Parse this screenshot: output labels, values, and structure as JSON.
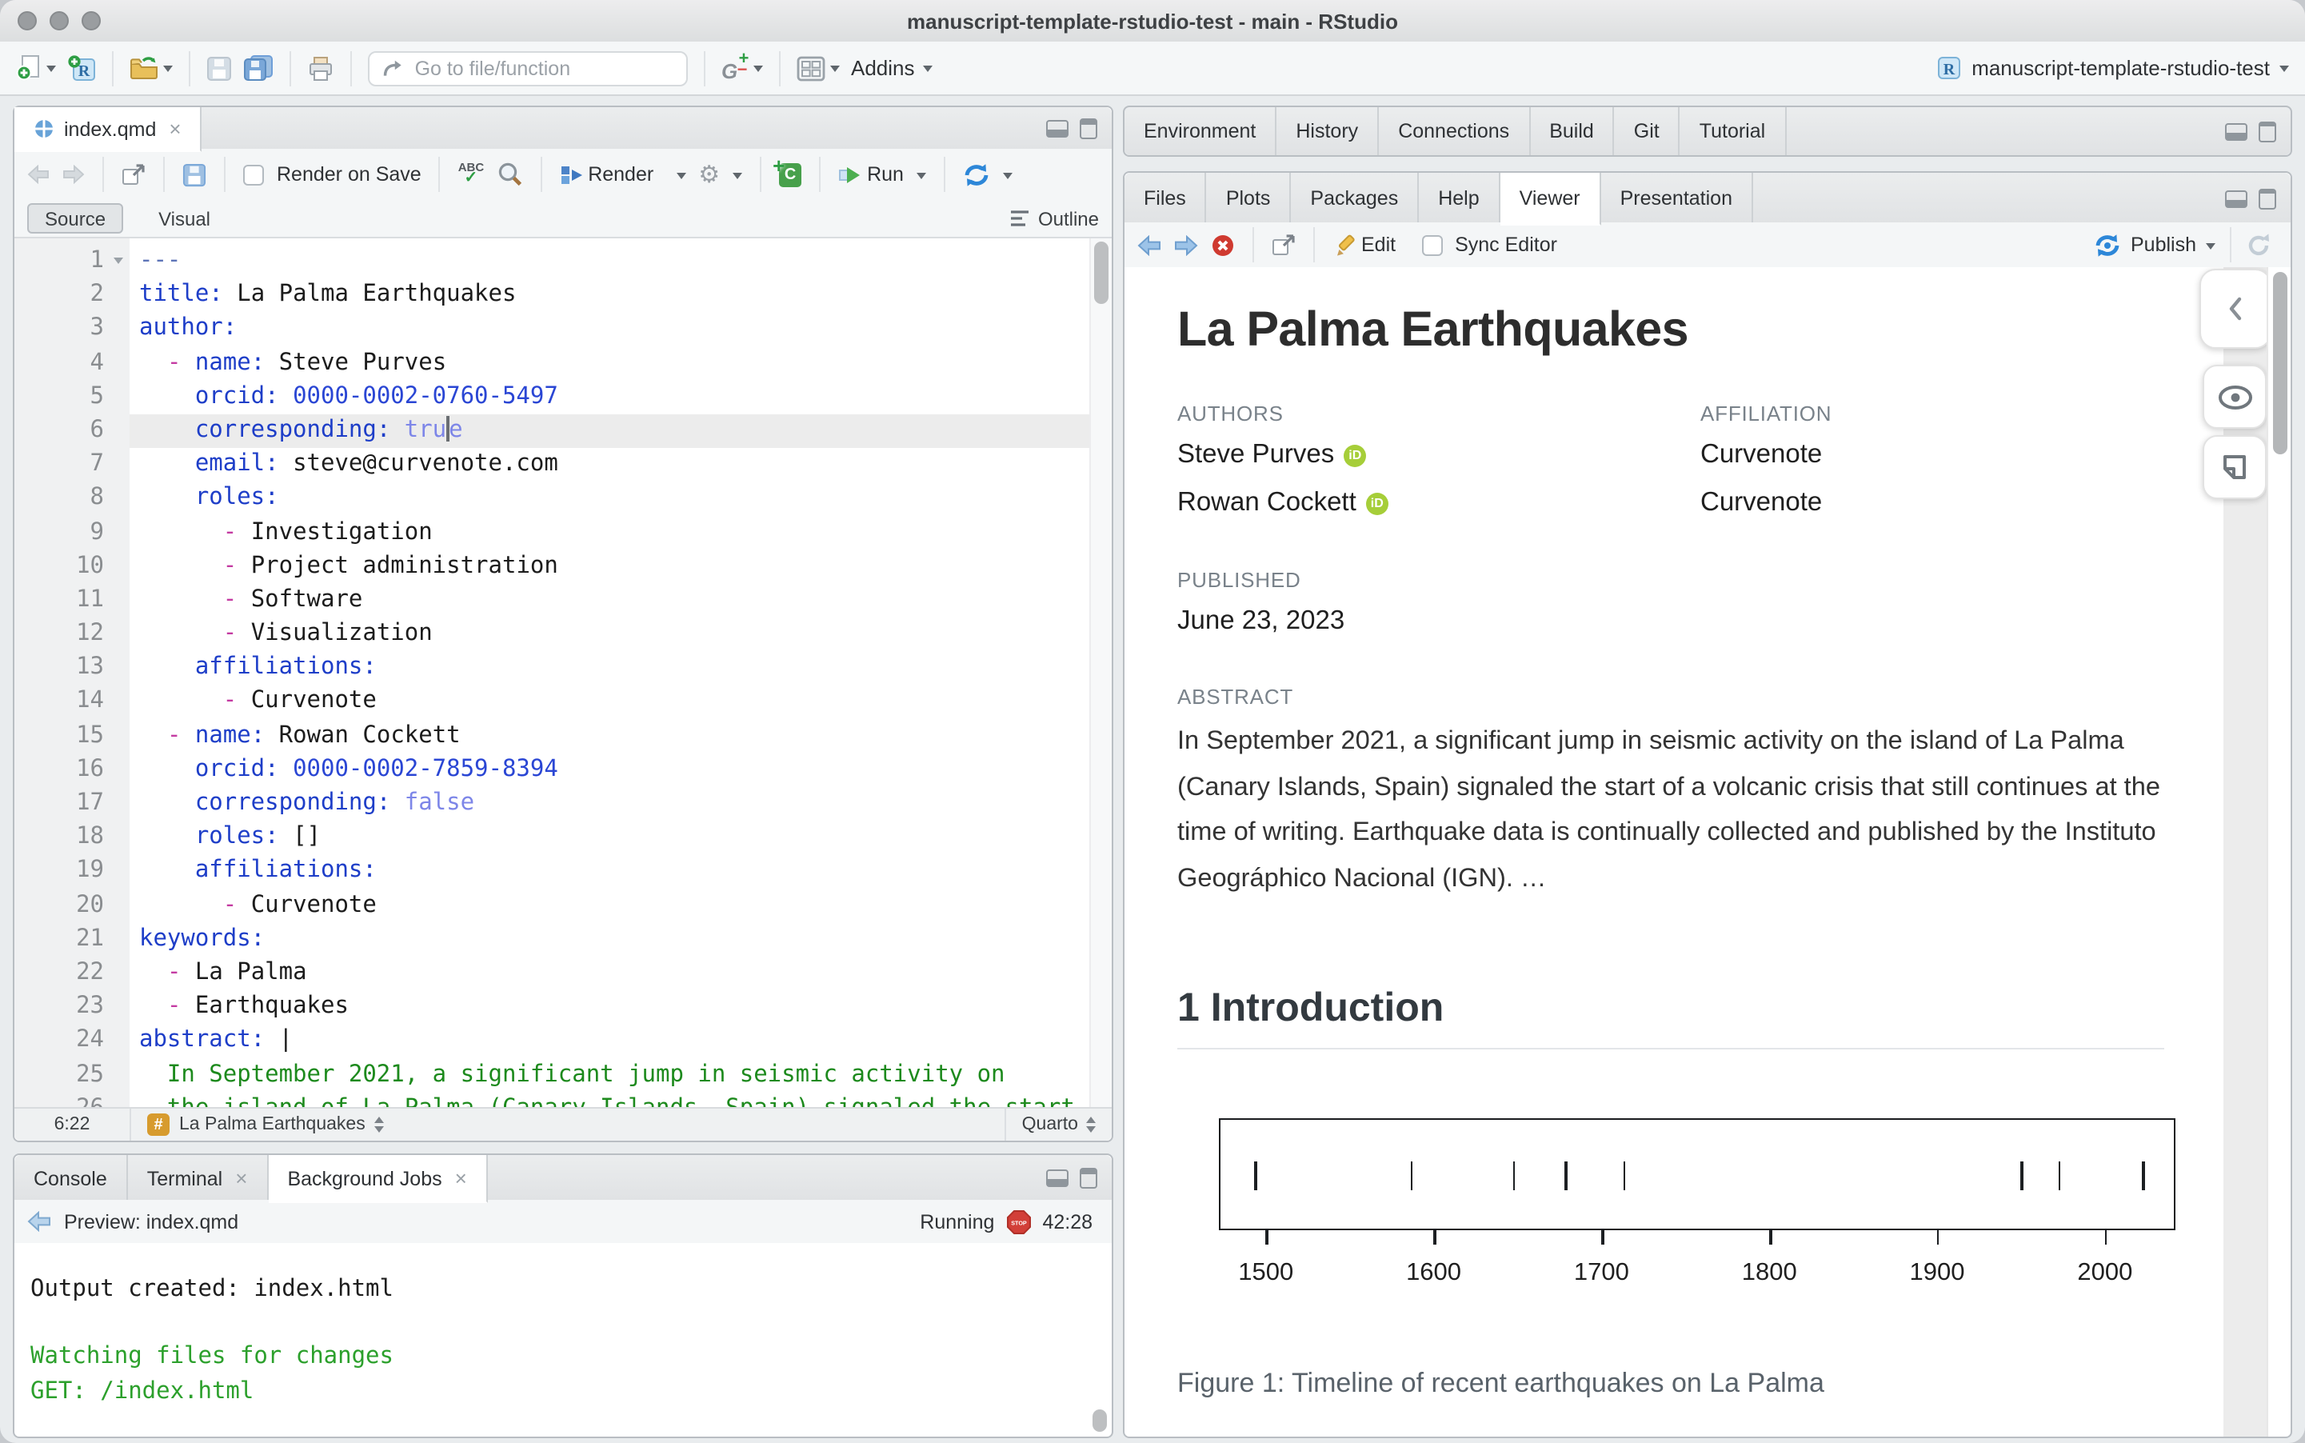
{
  "window": {
    "title": "manuscript-template-rstudio-test - main - RStudio"
  },
  "main_toolbar": {
    "goto_placeholder": "Go to file/function",
    "addins_label": "Addins",
    "project_label": "manuscript-template-rstudio-test"
  },
  "editor": {
    "tab": "index.qmd",
    "toolbar": {
      "render_on_save": "Render on Save",
      "render": "Render",
      "run": "Run"
    },
    "mode": {
      "source": "Source",
      "visual": "Visual",
      "outline": "Outline"
    },
    "current_line": 6,
    "lines": [
      {
        "t": [
          [
            "meta",
            "---"
          ]
        ]
      },
      {
        "t": [
          [
            "key",
            "title:"
          ],
          [
            "plain",
            " La Palma Earthquakes"
          ]
        ]
      },
      {
        "t": [
          [
            "key",
            "author:"
          ]
        ]
      },
      {
        "t": [
          [
            "plain",
            "  "
          ],
          [
            "dash",
            "-"
          ],
          [
            "plain",
            " "
          ],
          [
            "key",
            "name:"
          ],
          [
            "plain",
            " Steve Purves"
          ]
        ]
      },
      {
        "t": [
          [
            "plain",
            "    "
          ],
          [
            "key",
            "orcid:"
          ],
          [
            "num",
            " 0000-0002-0760-5497"
          ]
        ]
      },
      {
        "t": [
          [
            "plain",
            "    "
          ],
          [
            "key",
            "corresponding:"
          ],
          [
            "bool",
            " tru"
          ],
          [
            "caret",
            ""
          ],
          [
            "bool",
            "e"
          ]
        ]
      },
      {
        "t": [
          [
            "plain",
            "    "
          ],
          [
            "key",
            "email:"
          ],
          [
            "plain",
            " steve@curvenote.com"
          ]
        ]
      },
      {
        "t": [
          [
            "plain",
            "    "
          ],
          [
            "key",
            "roles:"
          ]
        ]
      },
      {
        "t": [
          [
            "plain",
            "      "
          ],
          [
            "dash",
            "-"
          ],
          [
            "plain",
            " Investigation"
          ]
        ]
      },
      {
        "t": [
          [
            "plain",
            "      "
          ],
          [
            "dash",
            "-"
          ],
          [
            "plain",
            " Project administration"
          ]
        ]
      },
      {
        "t": [
          [
            "plain",
            "      "
          ],
          [
            "dash",
            "-"
          ],
          [
            "plain",
            " Software"
          ]
        ]
      },
      {
        "t": [
          [
            "plain",
            "      "
          ],
          [
            "dash",
            "-"
          ],
          [
            "plain",
            " Visualization"
          ]
        ]
      },
      {
        "t": [
          [
            "plain",
            "    "
          ],
          [
            "key",
            "affiliations:"
          ]
        ]
      },
      {
        "t": [
          [
            "plain",
            "      "
          ],
          [
            "dash",
            "-"
          ],
          [
            "plain",
            " Curvenote"
          ]
        ]
      },
      {
        "t": [
          [
            "plain",
            "  "
          ],
          [
            "dash",
            "-"
          ],
          [
            "plain",
            " "
          ],
          [
            "key",
            "name:"
          ],
          [
            "plain",
            " Rowan Cockett"
          ]
        ]
      },
      {
        "t": [
          [
            "plain",
            "    "
          ],
          [
            "key",
            "orcid:"
          ],
          [
            "num",
            " 0000-0002-7859-8394"
          ]
        ]
      },
      {
        "t": [
          [
            "plain",
            "    "
          ],
          [
            "key",
            "corresponding:"
          ],
          [
            "bool",
            " false"
          ]
        ]
      },
      {
        "t": [
          [
            "plain",
            "    "
          ],
          [
            "key",
            "roles:"
          ],
          [
            "plain",
            " []"
          ]
        ]
      },
      {
        "t": [
          [
            "plain",
            "    "
          ],
          [
            "key",
            "affiliations:"
          ]
        ]
      },
      {
        "t": [
          [
            "plain",
            "      "
          ],
          [
            "dash",
            "-"
          ],
          [
            "plain",
            " Curvenote"
          ]
        ]
      },
      {
        "t": [
          [
            "key",
            "keywords:"
          ]
        ]
      },
      {
        "t": [
          [
            "plain",
            "  "
          ],
          [
            "dash",
            "-"
          ],
          [
            "plain",
            " La Palma"
          ]
        ]
      },
      {
        "t": [
          [
            "plain",
            "  "
          ],
          [
            "dash",
            "-"
          ],
          [
            "plain",
            " Earthquakes"
          ]
        ]
      },
      {
        "t": [
          [
            "key",
            "abstract:"
          ],
          [
            "plain",
            " |"
          ]
        ]
      },
      {
        "t": [
          [
            "str",
            "  In September 2021, a significant jump in seismic activity on"
          ]
        ]
      },
      {
        "t": [
          [
            "str",
            "  the island of La Palma (Canary Islands, Spain) signaled the start"
          ]
        ]
      }
    ],
    "status": {
      "position": "6:22",
      "section": "La Palma Earthquakes",
      "mode": "Quarto"
    }
  },
  "console": {
    "tabs": [
      {
        "label": "Console",
        "closable": false,
        "active": false
      },
      {
        "label": "Terminal",
        "closable": true,
        "active": false
      },
      {
        "label": "Background Jobs",
        "closable": true,
        "active": true
      }
    ],
    "toolbar": {
      "preview": "Preview: index.qmd",
      "status": "Running",
      "time": "42:28"
    },
    "output": [
      {
        "text": "Output created: index.html",
        "cls": "co-plain"
      },
      {
        "text": "",
        "cls": "co-plain"
      },
      {
        "text": "Watching files for changes",
        "cls": "co-green"
      },
      {
        "text": "GET: /index.html",
        "cls": "co-green"
      }
    ]
  },
  "env_tabs": [
    "Environment",
    "History",
    "Connections",
    "Build",
    "Git",
    "Tutorial"
  ],
  "viewer": {
    "tabs": [
      "Files",
      "Plots",
      "Packages",
      "Help",
      "Viewer",
      "Presentation"
    ],
    "active": "Viewer",
    "toolbar": {
      "edit": "Edit",
      "sync": "Sync Editor",
      "publish": "Publish"
    }
  },
  "page": {
    "title": "La Palma Earthquakes",
    "authors_label": "AUTHORS",
    "affiliation_label": "AFFILIATION",
    "authors": [
      {
        "name": "Steve Purves",
        "affiliation": "Curvenote"
      },
      {
        "name": "Rowan Cockett",
        "affiliation": "Curvenote"
      }
    ],
    "published_label": "PUBLISHED",
    "published": "June 23, 2023",
    "abstract_label": "ABSTRACT",
    "abstract": "In September 2021, a significant jump in seismic activity on the island of La Palma (Canary Islands, Spain) signaled the start of a volcanic crisis that still continues at the time of writing. Earthquake data is continually collected and published by the Instituto Geográphico Nacional (IGN). …",
    "section_heading": "1 Introduction"
  },
  "chart_data": {
    "type": "scatter",
    "subtype": "event-timeline-rug",
    "title": "",
    "xlabel": "",
    "ylabel": "",
    "x": [
      1492,
      1585,
      1646,
      1677,
      1712,
      1949,
      1971,
      2021
    ],
    "xticks": [
      1500,
      1600,
      1700,
      1800,
      1900,
      2000
    ],
    "xlim": [
      1472,
      2042
    ],
    "grid": false,
    "caption": "Figure 1: Timeline of recent earthquakes on La Palma"
  },
  "colors": {
    "accent_blue": "#2d87d8",
    "green_run": "#2e9e44",
    "orcid_green": "#a6ce39",
    "stop_red": "#d23f38",
    "syntax_key": "#1e3ec8",
    "syntax_bool": "#7d86e8",
    "syntax_dash": "#c43ba2",
    "syntax_string": "#1d8a1d",
    "console_green": "#2ca02c",
    "hash_badge": "#d79b2e"
  },
  "icons": {
    "new-doc-icon": "page+green-plus",
    "new-project-icon": "R-cube+green-plus",
    "open-folder-icon": "yellow-folder-arrow",
    "save-icon": "disk",
    "save-all-icon": "double-disk",
    "print-icon": "printer",
    "goto-icon": "curved-arrow",
    "git-icon": "G+plus-minus",
    "panes-icon": "2x2-grid",
    "spellcheck-icon": "ABC-check",
    "search-icon": "magnifier",
    "render-icon": "blue-grid",
    "gear-icon": "⚙",
    "chunk-icon": "+C",
    "run-icon": "green-play",
    "rerun-icon": "blue-circular-arrows",
    "publish-icon": "blue-circular-arrows-dot",
    "refresh-icon": "circular-arrow",
    "clear-icon": "red-x-circle",
    "edit-icon": "pencil",
    "stop-icon": "STOP-octagon",
    "back-icon": "block-arrow-left",
    "forward-icon": "block-arrow-right",
    "popout-icon": "window-arrow",
    "outline-icon": "3-lines",
    "quarto-icon": "blue-circle-cross",
    "orcid-icon": "iD",
    "collapse-icon": "‹",
    "preview-eye-icon": "eye",
    "comment-icon": "note"
  }
}
